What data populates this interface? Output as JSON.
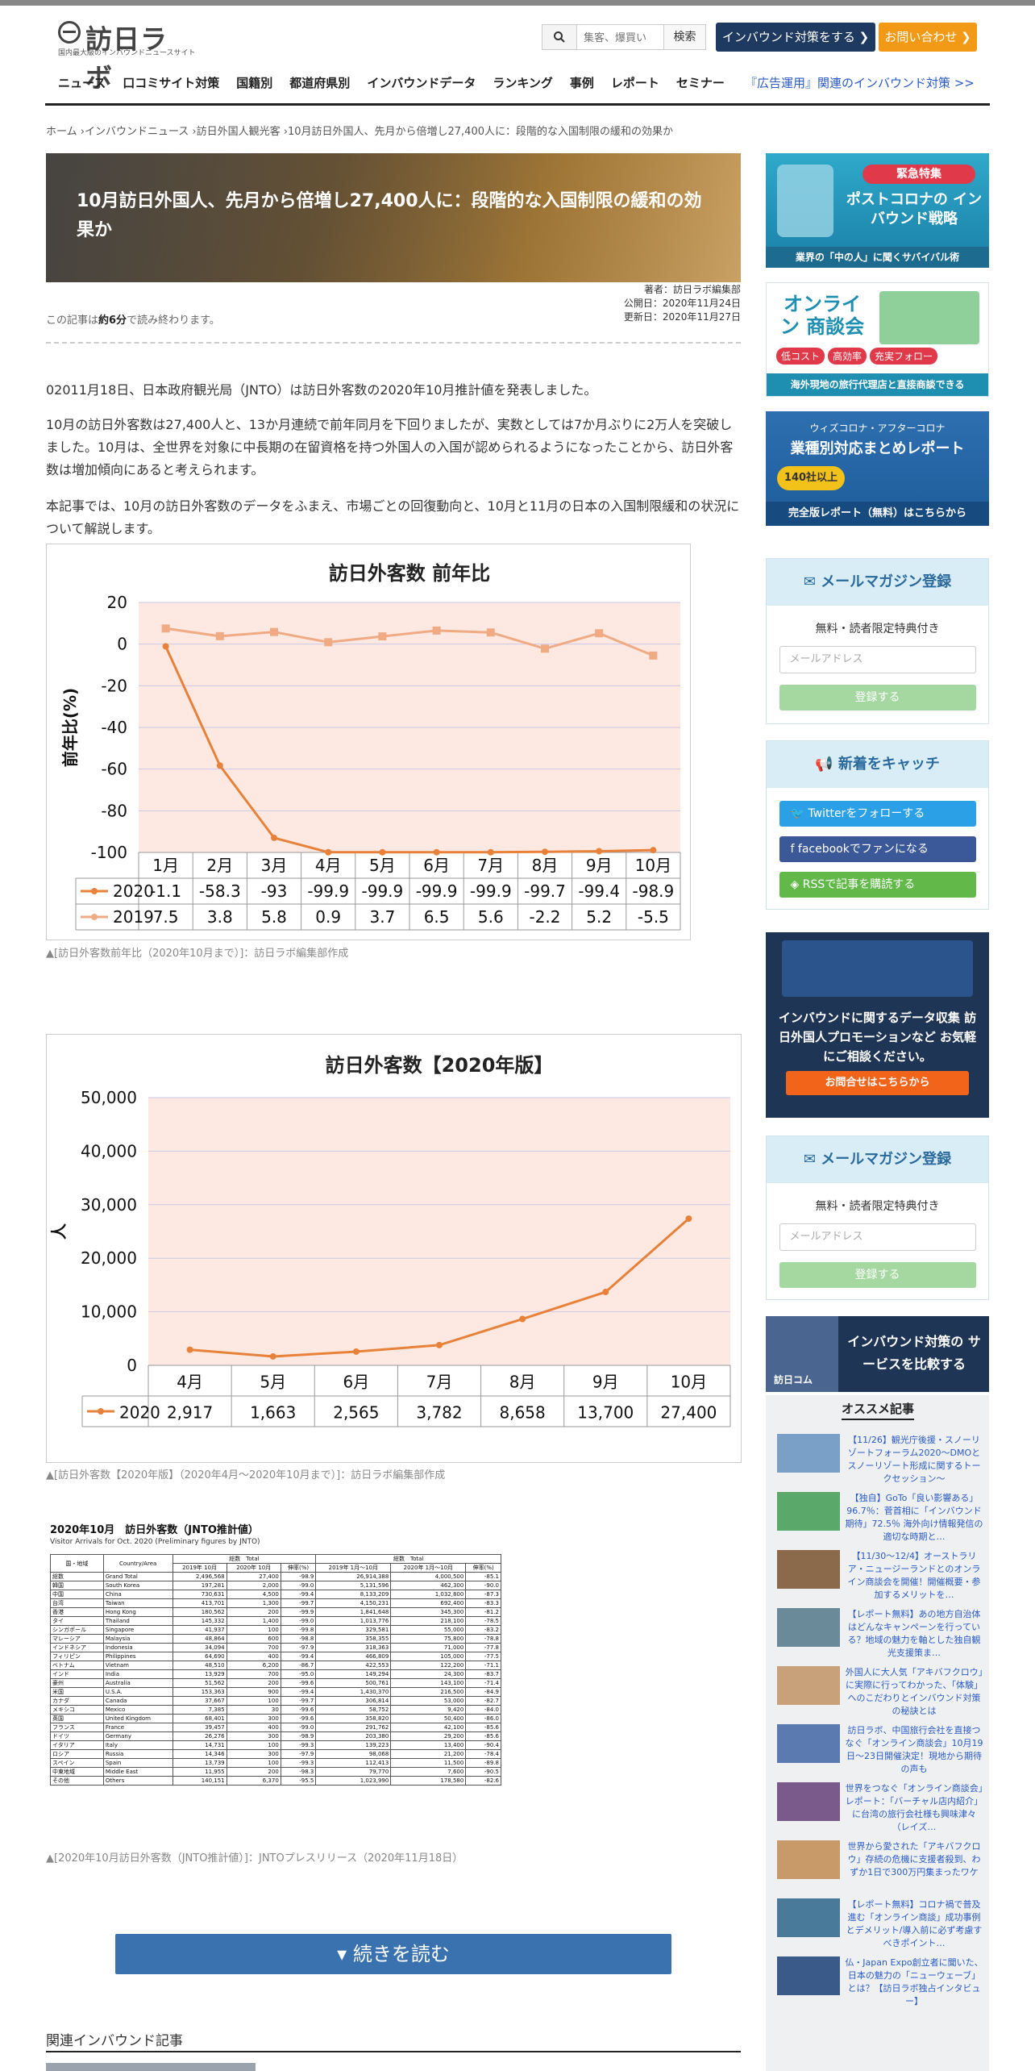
{
  "header": {
    "logo_name": "訪日ラボ",
    "logo_tagline": "国内最大級のインバウンドニュースサイト",
    "search_placeholder": "集客、爆買い",
    "search_button": "検索",
    "cta_inbound": "インバウンド対策をする ❯",
    "cta_contact": "お問い合わせ ❯"
  },
  "nav": {
    "items": [
      "ニュース",
      "口コミサイト対策",
      "国籍別",
      "都道府県別",
      "インバウンドデータ",
      "ランキング",
      "事例",
      "レポート",
      "セミナー"
    ],
    "ad_link": "『広告運用』関連のインバウンド対策 >>"
  },
  "breadcrumb": "ホーム ›インバウンドニュース ›訪日外国人観光客 ›10月訪日外国人、先月から倍増し27,400人に：段階的な入国制限の緩和の効果か",
  "article": {
    "title": "10月訪日外国人、先月から倍増し27,400人に：段階的な入国制限の緩和の効果か",
    "author": "著者：訪日ラボ編集部",
    "published": "公開日：2020年11月24日",
    "updated": "更新日：2020年11月27日",
    "read_pre": "この記事は",
    "read_time": "約6分",
    "read_post": "で読み終わります。",
    "p1": "02011月18日、日本政府観光局（JNTO）は訪日外客数の2020年10月推計値を発表しました。",
    "p2": "10月の訪日外客数は27,400人と、13か月連続で前年同月を下回りましたが、実数としては7か月ぶりに2万人を突破しました。10月は、全世界を対象に中長期の在留資格を持つ外国人の入国が認められるようになったことから、訪日外客数は増加傾向にあると考えられます。",
    "p3": "本記事では、10月の訪日外客数のデータをふまえ、市場ごとの回復動向と、10月と11月の日本の入国制限緩和の状況について解説します。",
    "cap1": "▲[訪日外客数前年比（2020年10月まで）]：訪日ラボ編集部作成",
    "cap2": "▲[訪日外客数【2020年版】（2020年4月～2020年10月まで）]：訪日ラボ編集部作成",
    "cap3": "▲[2020年10月訪日外客数（JNTO推計値）]：JNTOプレスリリース（2020年11月18日）",
    "read_more": "続きを読む",
    "related": "関連インバウンド記事"
  },
  "chart_data": [
    {
      "type": "line",
      "title": "訪日外客数 前年比",
      "ylabel": "前年比(%)",
      "xlabel": "",
      "categories": [
        "1月",
        "2月",
        "3月",
        "4月",
        "5月",
        "6月",
        "7月",
        "8月",
        "9月",
        "10月"
      ],
      "series": [
        {
          "name": "2020",
          "values": [
            -1.1,
            -58.3,
            -93,
            -99.9,
            -99.9,
            -99.9,
            -99.9,
            -99.7,
            -99.4,
            -98.9
          ],
          "labels": [
            "-1.1",
            "-58.3",
            "-93",
            "-99.9",
            "-99.9",
            "-99.9",
            "-99.9",
            "-99.7",
            "-99.4",
            "-98.9"
          ],
          "color": "#e8823a"
        },
        {
          "name": "2019",
          "values": [
            7.5,
            3.8,
            5.8,
            0.9,
            3.7,
            6.5,
            5.6,
            -2.2,
            5.2,
            -5.5
          ],
          "labels": [
            "7.5",
            "3.8",
            "5.8",
            "0.9",
            "3.7",
            "6.5",
            "5.6",
            "-2.2",
            "5.2",
            "-5.5"
          ],
          "color": "#f0ab85"
        }
      ],
      "ylim": [
        -100,
        20
      ],
      "yticks": [
        "20",
        "0",
        "-20",
        "-40",
        "-60",
        "-80",
        "-100"
      ],
      "grid": true,
      "legend": "data-table"
    },
    {
      "type": "line",
      "title": "訪日外客数【2020年版】",
      "ylabel": "人",
      "xlabel": "",
      "categories": [
        "4月",
        "5月",
        "6月",
        "7月",
        "8月",
        "9月",
        "10月"
      ],
      "series": [
        {
          "name": "2020",
          "values": [
            2917,
            1663,
            2565,
            3782,
            8658,
            13700,
            27400
          ],
          "labels": [
            "2,917",
            "1,663",
            "2,565",
            "3,782",
            "8,658",
            "13,700",
            "27,400"
          ],
          "color": "#e8823a"
        }
      ],
      "ylim": [
        0,
        50000
      ],
      "yticks": [
        "50,000",
        "40,000",
        "30,000",
        "20,000",
        "10,000",
        "0"
      ],
      "grid": true,
      "legend": "data-table"
    }
  ],
  "jnto_table": {
    "title": "2020年10月　訪日外客数（JNTO推計値）",
    "subtitle": "Visitor Arrivals for Oct. 2020 (Preliminary figures by JNTO)",
    "head_group1": "総数　Total",
    "head_group2": "総数　Total",
    "headers": [
      "国・地域",
      "Country/Area",
      "2019年 10月",
      "2020年 10月",
      "伸率(%)",
      "2019年 1月～10月",
      "2020年 1月～10月",
      "伸率(%)"
    ],
    "rows": [
      [
        "総数",
        "Grand Total",
        "2,496,568",
        "27,400",
        "-98.9",
        "26,914,388",
        "4,000,500",
        "-85.1"
      ],
      [
        "韓国",
        "South Korea",
        "197,281",
        "2,000",
        "-99.0",
        "5,131,596",
        "462,300",
        "-90.0"
      ],
      [
        "中国",
        "China",
        "730,631",
        "4,500",
        "-99.4",
        "8,133,209",
        "1,032,800",
        "-87.3"
      ],
      [
        "台湾",
        "Taiwan",
        "413,701",
        "1,300",
        "-99.7",
        "4,150,231",
        "692,400",
        "-83.3"
      ],
      [
        "香港",
        "Hong Kong",
        "180,562",
        "200",
        "-99.9",
        "1,841,648",
        "345,300",
        "-81.2"
      ],
      [
        "タイ",
        "Thailand",
        "145,332",
        "1,400",
        "-99.0",
        "1,013,776",
        "218,100",
        "-78.5"
      ],
      [
        "シンガポール",
        "Singapore",
        "41,937",
        "100",
        "-99.8",
        "329,581",
        "55,000",
        "-83.2"
      ],
      [
        "マレーシア",
        "Malaysia",
        "48,864",
        "600",
        "-98.8",
        "358,355",
        "75,800",
        "-78.8"
      ],
      [
        "インドネシア",
        "Indonesia",
        "34,094",
        "700",
        "-97.9",
        "318,363",
        "71,000",
        "-77.8"
      ],
      [
        "フィリピン",
        "Philippines",
        "64,690",
        "400",
        "-99.4",
        "466,809",
        "105,000",
        "-77.5"
      ],
      [
        "ベトナム",
        "Vietnam",
        "48,510",
        "6,200",
        "-86.7",
        "422,553",
        "122,200",
        "-71.1"
      ],
      [
        "インド",
        "India",
        "13,929",
        "700",
        "-95.0",
        "149,294",
        "24,300",
        "-83.7"
      ],
      [
        "豪州",
        "Australia",
        "51,562",
        "200",
        "-99.6",
        "500,761",
        "143,100",
        "-71.4"
      ],
      [
        "米国",
        "U.S.A.",
        "153,363",
        "900",
        "-99.4",
        "1,430,370",
        "216,500",
        "-84.9"
      ],
      [
        "カナダ",
        "Canada",
        "37,667",
        "100",
        "-99.7",
        "306,814",
        "53,000",
        "-82.7"
      ],
      [
        "メキシコ",
        "Mexico",
        "7,385",
        "30",
        "-99.6",
        "58,752",
        "9,420",
        "-84.0"
      ],
      [
        "英国",
        "United Kingdom",
        "68,401",
        "300",
        "-99.6",
        "358,820",
        "50,400",
        "-86.0"
      ],
      [
        "フランス",
        "France",
        "39,457",
        "400",
        "-99.0",
        "291,762",
        "42,100",
        "-85.6"
      ],
      [
        "ドイツ",
        "Germany",
        "26,276",
        "300",
        "-98.9",
        "203,380",
        "29,200",
        "-85.6"
      ],
      [
        "イタリア",
        "Italy",
        "14,731",
        "100",
        "-99.3",
        "139,223",
        "13,400",
        "-90.4"
      ],
      [
        "ロシア",
        "Russia",
        "14,346",
        "300",
        "-97.9",
        "98,068",
        "21,200",
        "-78.4"
      ],
      [
        "スペイン",
        "Spain",
        "13,739",
        "100",
        "-99.3",
        "112,413",
        "11,500",
        "-89.8"
      ],
      [
        "中東地域",
        "Middle East",
        "11,955",
        "200",
        "-98.3",
        "79,770",
        "7,600",
        "-90.5"
      ],
      [
        "その他",
        "Others",
        "140,151",
        "6,370",
        "-95.5",
        "1,023,990",
        "178,580",
        "-82.6"
      ]
    ]
  },
  "sidebar": {
    "banner1_badge": "緊急特集",
    "banner1_title": "ポストコロナの インバウンド戦略",
    "banner1_foot": "業界の「中の人」に聞くサバイバル術",
    "banner2_title": "オンライン 商談会",
    "banner2_tags": [
      "低コスト",
      "高効率",
      "充実フォロー"
    ],
    "banner2_foot": "海外現地の旅行代理店と直接商談できる",
    "banner3_kicker": "ウィズコロナ・アフターコロナ",
    "banner3_title": "業種別対応まとめレポート",
    "banner3_badge": "140社以上",
    "banner3_foot": "完全版レポート（無料）はこちらから",
    "mail1_title": "メールマガジン登録",
    "mail1_sub": "無料・読者限定特典付き",
    "mail1_placeholder": "メールアドレス",
    "mail1_button": "登録する",
    "follow_title": "新着をキャッチ",
    "follow_twitter": "Twitterをフォローする",
    "follow_facebook": "facebookでファンになる",
    "follow_rss": "RSSで記事を購読する",
    "banner4_text": "インバウンドに関するデータ収集 訪日外国人プロモーションなど お気軽にご相談ください。",
    "banner4_button": "お問合せはこちらから",
    "mail2_title": "メールマガジン登録",
    "mail2_sub": "無料・読者限定特典付き",
    "mail2_placeholder": "メールアドレス",
    "mail2_button": "登録する",
    "banner5_text": "インバウンド対策の サービスを比較する",
    "banner5_brand": "訪日コム",
    "osusume_title": "オススメ記事",
    "osusume": [
      "【11/26】観光庁後援・スノーリゾートフォーラム2020～DMOとスノーリゾート形成に関するトークセッション～",
      "【独自】GoTo「良い影響ある」96.7％：菅首相に「インバウンド期待」72.5％ 海外向け情報発信の適切な時期と…",
      "【11/30～12/4】オーストラリア・ニュージーランドとのオンライン商談会を開催！開催概要・参加するメリットを…",
      "【レポート無料】あの地方自治体はどんなキャンペーンを行っている？地域の魅力を軸とした独自観光支援策ま…",
      "外国人に大人気「アキバフクロウ」に実際に行ってわかった、「体験」へのこだわりとインバウンド対策の秘訣とは",
      "訪日ラボ、中国旅行会社を直接つなぐ「オンライン商談会」10月19日～23日開催決定！現地から期待の声も",
      "世界をつなぐ「オンライン商談会」レポート：「バーチャル店内紹介」に台湾の旅行会社様も興味津々（レイズ…",
      "世界から愛された「アキバフクロウ」存続の危機に支援者殺到、わずか1日で300万円集まったワケ",
      "【レポート無料】コロナ禍で普及進む「オンライン商談」成功事例とデメリット/導入前に必ず考慮すべきポイント…",
      "仏・Japan Expo創立者に聞いた、日本の魅力の「ニューウェーブ」とは？【訪日ラボ独占インタビュー】"
    ]
  }
}
